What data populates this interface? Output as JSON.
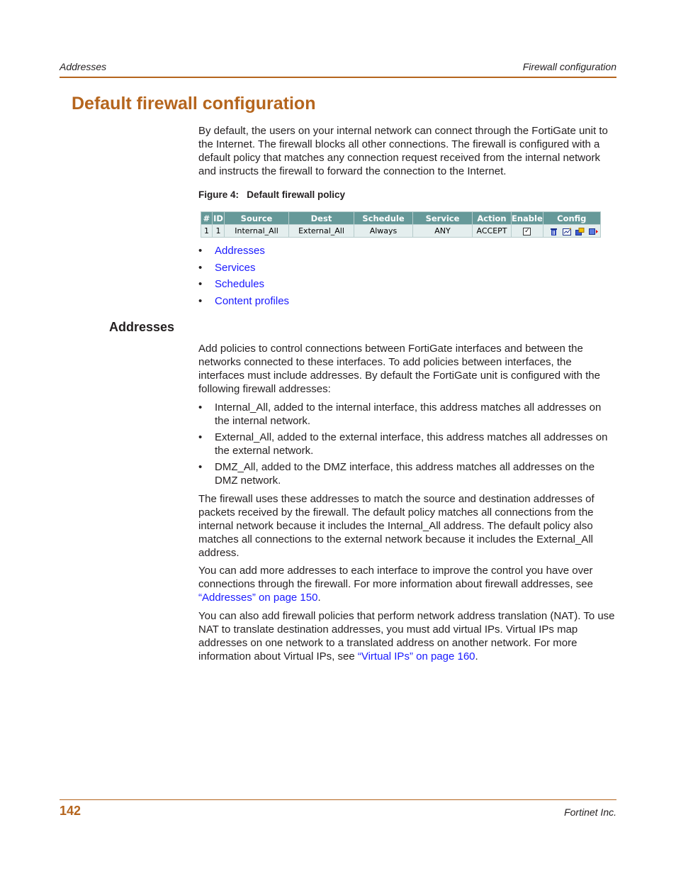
{
  "header": {
    "left": "Addresses",
    "right": "Firewall configuration"
  },
  "title": "Default firewall configuration",
  "intro": "By default, the users on your internal network can connect through the FortiGate unit to the Internet. The firewall blocks all other connections. The firewall is configured with a default policy that matches any connection request received from the internal network and instructs the firewall to forward the connection to the Internet.",
  "figure": {
    "caption": "Figure 4:   Default firewall policy",
    "columns": [
      "#",
      "ID",
      "Source",
      "Dest",
      "Schedule",
      "Service",
      "Action",
      "Enable",
      "Config"
    ],
    "rows": [
      {
        "num": "1",
        "id": "1",
        "source": "Internal_All",
        "dest": "External_All",
        "schedule": "Always",
        "service": "ANY",
        "action": "ACCEPT",
        "enable": true,
        "check": "✓"
      }
    ],
    "config_icons": [
      "delete-icon",
      "edit-icon",
      "insert-policy-icon",
      "move-icon"
    ]
  },
  "link_list": [
    "Addresses",
    "Services",
    "Schedules",
    "Content profiles"
  ],
  "bullet_char": "•",
  "section": {
    "heading": "Addresses",
    "p1": "Add policies to control connections between FortiGate interfaces and between the networks connected to these interfaces. To add policies between interfaces, the interfaces must include addresses. By default the FortiGate unit is configured with the following firewall addresses:",
    "bullets": [
      "Internal_All, added to the internal interface, this address matches all addresses on the internal network.",
      "External_All, added to the external interface, this address matches all addresses on the external network.",
      "DMZ_All, added to the DMZ interface, this address matches all addresses on the DMZ network."
    ],
    "p2": "The firewall uses these addresses to match the source and destination addresses of packets received by the firewall. The default policy matches all connections from the internal network because it includes the Internal_All address. The default policy also matches all connections to the external network because it includes the External_All address.",
    "p3_before": "You can add more addresses to each interface to improve the control you have over connections through the firewall. For more information about firewall addresses, see ",
    "p3_link": "“Addresses” on page 150",
    "p3_after": ".",
    "p4_before": "You can also add firewall policies that perform network address translation (NAT). To use NAT to translate destination addresses, you must add virtual IPs. Virtual IPs map addresses on one network to a translated address on another network. For more information about Virtual IPs, see ",
    "p4_link": "“Virtual IPs” on page 160",
    "p4_after": "."
  },
  "footer": {
    "page": "142",
    "company": "Fortinet Inc."
  },
  "colors": {
    "accent": "#b5651d",
    "link": "#1a1aff",
    "table_header": "#669999",
    "table_row": "#e4eeee"
  }
}
